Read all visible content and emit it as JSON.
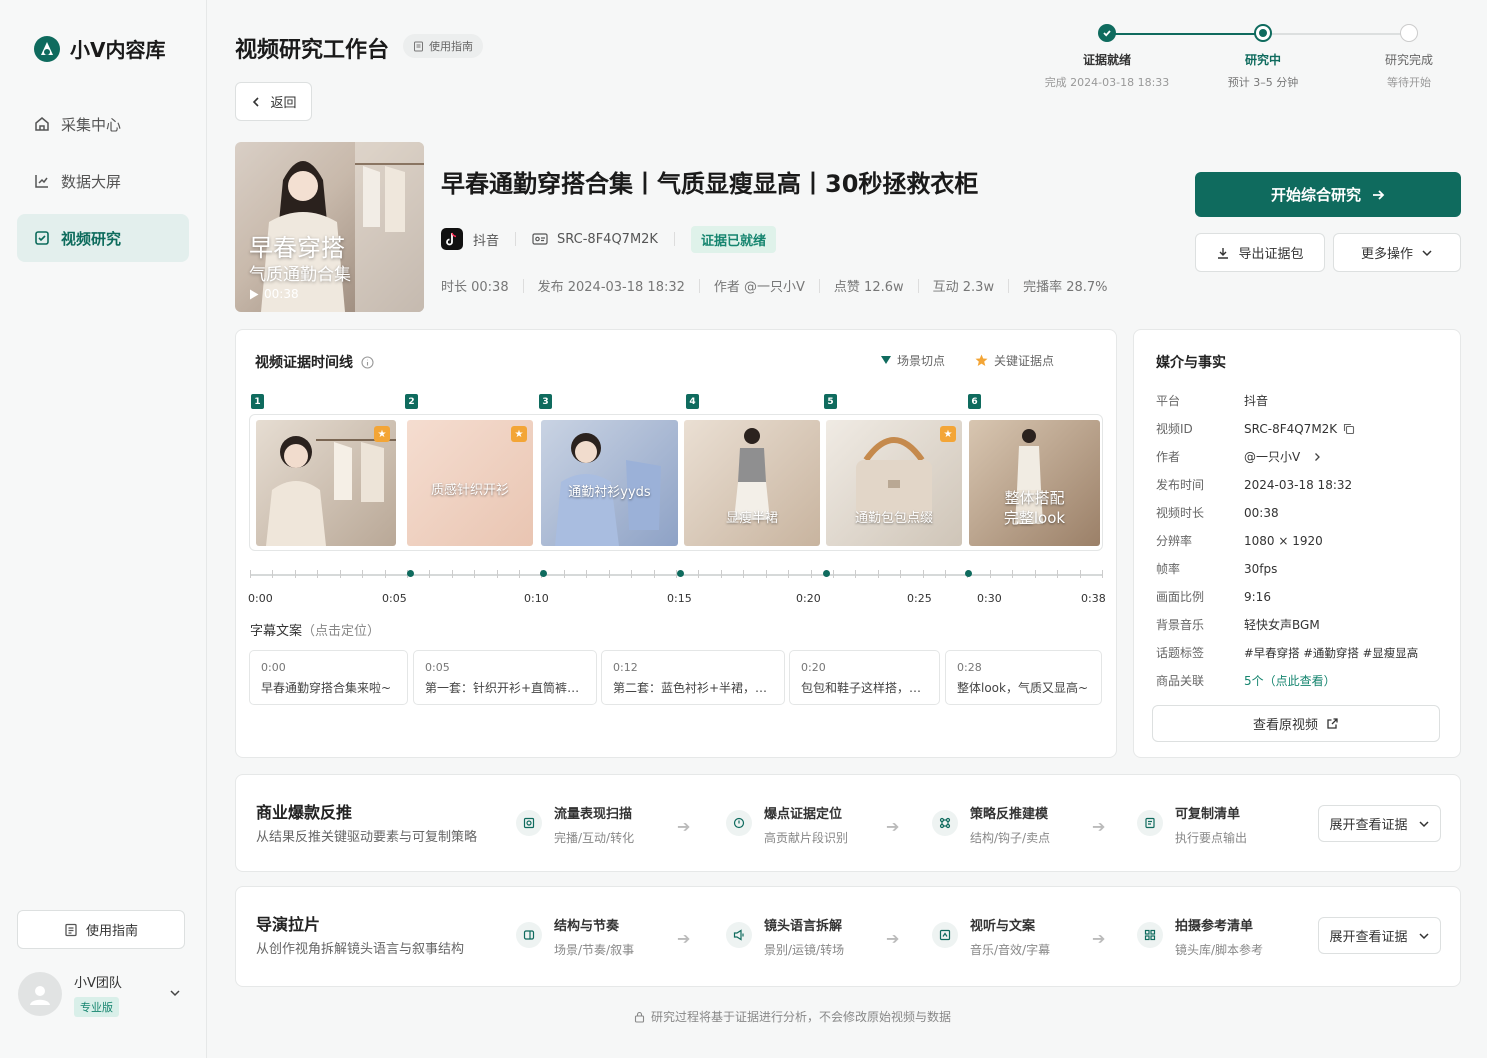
{
  "app": {
    "name": "小V内容库"
  },
  "sidebar": {
    "items": [
      {
        "label": "采集中心",
        "icon": "home-icon",
        "active": false
      },
      {
        "label": "数据大屏",
        "icon": "chart-icon",
        "active": false
      },
      {
        "label": "视频研究",
        "icon": "research-icon",
        "active": true
      }
    ],
    "guide_label": "使用指南",
    "team": {
      "name": "小V团队",
      "badge": "专业版"
    }
  },
  "header": {
    "title": "视频研究工作台",
    "guide_chip": "使用指南",
    "back_label": "返回"
  },
  "stepper": [
    {
      "name": "证据就绪",
      "sub": "完成 2024-03-18 18:33",
      "state": "done"
    },
    {
      "name": "研究中",
      "sub": "预计 3–5 分钟",
      "state": "current"
    },
    {
      "name": "研究完成",
      "sub": "等待开始",
      "state": "pending"
    }
  ],
  "video": {
    "cover_line1": "早春穿搭",
    "cover_line2": "气质通勤合集",
    "cover_duration": "00:38",
    "title": "早春通勤穿搭合集丨气质显瘦显高丨30秒拯救衣柜",
    "platform": "抖音",
    "source_id": "SRC-8F4Q7M2K",
    "status_tag": "证据已就绪",
    "meta": [
      "时长 00:38",
      "发布 2024-03-18 18:32",
      "作者 @一只小V",
      "点赞 12.6w",
      "互动 2.3w",
      "完播率 28.7%"
    ]
  },
  "actions": {
    "primary": "开始综合研究",
    "export": "导出证据包",
    "more": "更多操作"
  },
  "timeline": {
    "title": "视频证据时间线",
    "legend_scene": "场景切点",
    "legend_key": "关键证据点",
    "frames": [
      {
        "pin": "1",
        "caption": "",
        "star": true
      },
      {
        "pin": "2",
        "caption": "质感针织开衫",
        "star": true
      },
      {
        "pin": "3",
        "caption": "通勤衬衫yyds",
        "star": false
      },
      {
        "pin": "4",
        "caption": "显瘦半裙",
        "star": false
      },
      {
        "pin": "5",
        "caption": "通勤包包点缀",
        "star": true
      },
      {
        "pin": "6",
        "caption": "整体搭配\n完整look",
        "star": false
      }
    ],
    "axis_labels": [
      "0:00",
      "0:05",
      "0:10",
      "0:15",
      "0:20",
      "0:25",
      "0:30",
      "0:38"
    ],
    "subtitle_label": "字幕文案",
    "subtitle_hint": "（点击定位）",
    "subtitles": [
      {
        "time": "0:00",
        "text": "早春通勤穿搭合集来啦~"
      },
      {
        "time": "0:05",
        "text": "第一套：针织开衫+直筒裤，…"
      },
      {
        "time": "0:12",
        "text": "第二套：蓝色衬衫+半裙，…"
      },
      {
        "time": "0:20",
        "text": "包包和鞋子这样搭，…"
      },
      {
        "time": "0:28",
        "text": "整体look，气质又显高~"
      }
    ]
  },
  "facts": {
    "title": "媒介与事实",
    "rows": [
      {
        "k": "平台",
        "v": "抖音"
      },
      {
        "k": "视频ID",
        "v": "SRC-8F4Q7M2K"
      },
      {
        "k": "作者",
        "v": "@一只小V"
      },
      {
        "k": "发布时间",
        "v": "2024-03-18 18:32"
      },
      {
        "k": "视频时长",
        "v": "00:38"
      },
      {
        "k": "分辨率",
        "v": "1080 × 1920"
      },
      {
        "k": "帧率",
        "v": "30fps"
      },
      {
        "k": "画面比例",
        "v": "9:16"
      },
      {
        "k": "背景音乐",
        "v": "轻快女声BGM"
      },
      {
        "k": "话题标签",
        "v": "#早春穿搭 #通勤穿搭 #显瘦显高"
      },
      {
        "k": "商品关联",
        "v": "5个（点此查看）"
      }
    ],
    "view_original": "查看原视频"
  },
  "flows": [
    {
      "title": "商业爆款反推",
      "sub": "从结果反推关键驱动要素与可复制策略",
      "steps": [
        {
          "name": "流量表现扫描",
          "desc": "完播/互动/转化"
        },
        {
          "name": "爆点证据定位",
          "desc": "高贡献片段识别"
        },
        {
          "name": "策略反推建模",
          "desc": "结构/钩子/卖点"
        },
        {
          "name": "可复制清单",
          "desc": "执行要点输出"
        }
      ],
      "expand": "展开查看证据"
    },
    {
      "title": "导演拉片",
      "sub": "从创作视角拆解镜头语言与叙事结构",
      "steps": [
        {
          "name": "结构与节奏",
          "desc": "场景/节奏/叙事"
        },
        {
          "name": "镜头语言拆解",
          "desc": "景别/运镜/转场"
        },
        {
          "name": "视听与文案",
          "desc": "音乐/音效/字幕"
        },
        {
          "name": "拍摄参考清单",
          "desc": "镜头库/脚本参考"
        }
      ],
      "expand": "展开查看证据"
    }
  ],
  "footer": "研究过程将基于证据进行分析，不会修改原始视频与数据",
  "colors": {
    "brand": "#0f6b5e",
    "accent_star": "#f3a536",
    "status_green": "#16856f"
  }
}
